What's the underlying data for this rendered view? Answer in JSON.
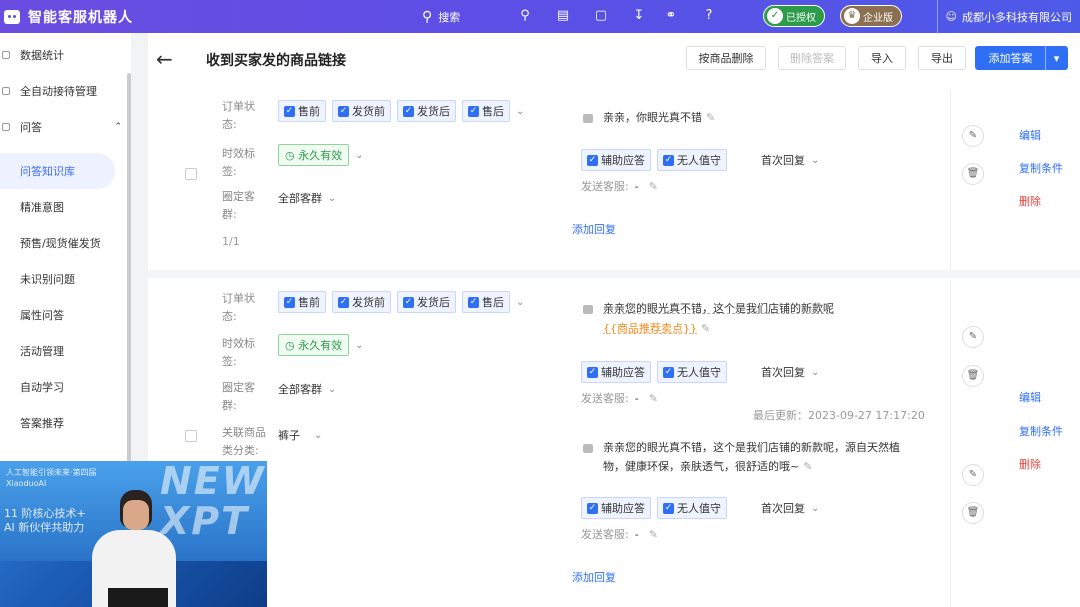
{
  "topbar": {
    "brand": "智能客服机器人",
    "search_label": "搜索",
    "badge_authorized": "已授权",
    "badge_enterprise": "企业版",
    "company": "成都小多科技有限公司"
  },
  "sidebar": {
    "items": [
      {
        "label": "数据统计"
      },
      {
        "label": "全自动接待管理"
      },
      {
        "label": "问答"
      },
      {
        "label": "问答知识库"
      },
      {
        "label": "精准意图"
      },
      {
        "label": "预售/现货催发货"
      },
      {
        "label": "未识别问题"
      },
      {
        "label": "属性问答"
      },
      {
        "label": "活动管理"
      },
      {
        "label": "自动学习"
      },
      {
        "label": "答案推荐"
      }
    ]
  },
  "header": {
    "title": "收到买家发的商品链接",
    "btn_delete_by_product": "按商品删除",
    "btn_delete_answer": "删除答案",
    "btn_import": "导入",
    "btn_export": "导出",
    "btn_add_answer": "添加答案"
  },
  "labels": {
    "order_status": "订单状态:",
    "time_tag": "时效标签:",
    "customer_group": "圈定客群:",
    "related_category": "关联商品类分类:",
    "send_agent": "发送客服:",
    "add_reply": "添加回复",
    "edit": "编辑",
    "copy_condition": "复制条件",
    "delete": "删除"
  },
  "order_statuses": [
    "售前",
    "发货前",
    "发货后",
    "售后"
  ],
  "time_tag_value": "永久有效",
  "customer_group_value": "全部客群",
  "pagination": "1/1",
  "category_value": "裤子",
  "tags": {
    "assist": "辅助应答",
    "unattended": "无人值守",
    "first_reply": "首次回复"
  },
  "send_agent_value": "-",
  "replies": {
    "r1": "亲亲，你眼光真不错",
    "r2_line1": "亲亲您的眼光真不错，这个是我们店铺的新款呢",
    "r2_var": "{{商品推荐卖点}}",
    "r3_line1": "亲亲您的眼光真不错，这个是我们店铺的新款呢，源自天然植",
    "r3_line2": "物，健康环保，亲肤透气，很舒适的哦~",
    "last_updated": "最后更新：2023-09-27 17:17:20"
  },
  "video": {
    "small_line1": "人工智能引领未来·第四届",
    "small_line2": "XiaoduoAI",
    "line_a": "11 阶核心技术+",
    "line_b": "AI 新伙伴共助力",
    "big": "NEW XPT"
  },
  "colors": {
    "primary": "#2f6ff5",
    "topbar": "#5b4fe6",
    "success": "#2c9b4a",
    "danger": "#e04040"
  }
}
